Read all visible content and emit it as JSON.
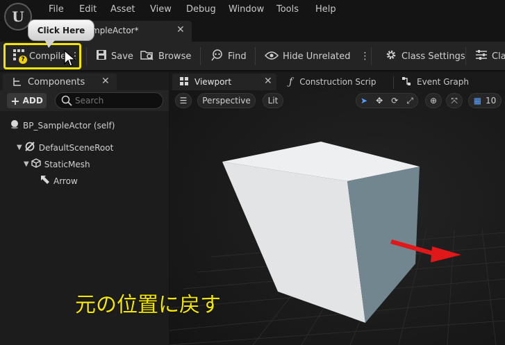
{
  "menu": {
    "logo": "U",
    "items": [
      "File",
      "Edit",
      "Asset",
      "View",
      "Debug",
      "Window",
      "Tools",
      "Help"
    ]
  },
  "asset_tab": {
    "label": "mpleActor*",
    "close": "✕"
  },
  "toolbar": {
    "compile": "Compile",
    "compile_badge": "?",
    "save": "Save",
    "browse": "Browse",
    "find": "Find",
    "hide_unrelated": "Hide Unrelated",
    "class_settings": "Class Settings",
    "class_defaults_partial": "Cla"
  },
  "callout": {
    "text": "Click Here"
  },
  "components_panel": {
    "tab_label": "Components",
    "add_label": "ADD",
    "search_placeholder": "Search",
    "tree": [
      {
        "label": "BP_SampleActor (self)",
        "icon": "actor-sphere-icon"
      },
      {
        "label": "DefaultSceneRoot",
        "icon": "scene-root-icon"
      },
      {
        "label": "StaticMesh",
        "icon": "static-mesh-icon"
      },
      {
        "label": "Arrow",
        "icon": "arrow-component-icon"
      }
    ]
  },
  "viewport": {
    "tabs": [
      "Viewport",
      "Construction Scrip",
      "Event Graph"
    ],
    "perspective": "Perspective",
    "lit": "Lit",
    "grid_snap_value": "10"
  },
  "caption": "元の位置に戻す",
  "colors": {
    "highlight": "#f2e600",
    "arrow_red": "#e0181a",
    "cube_light": "#e8e9eb",
    "cube_side": "#6f8590"
  }
}
